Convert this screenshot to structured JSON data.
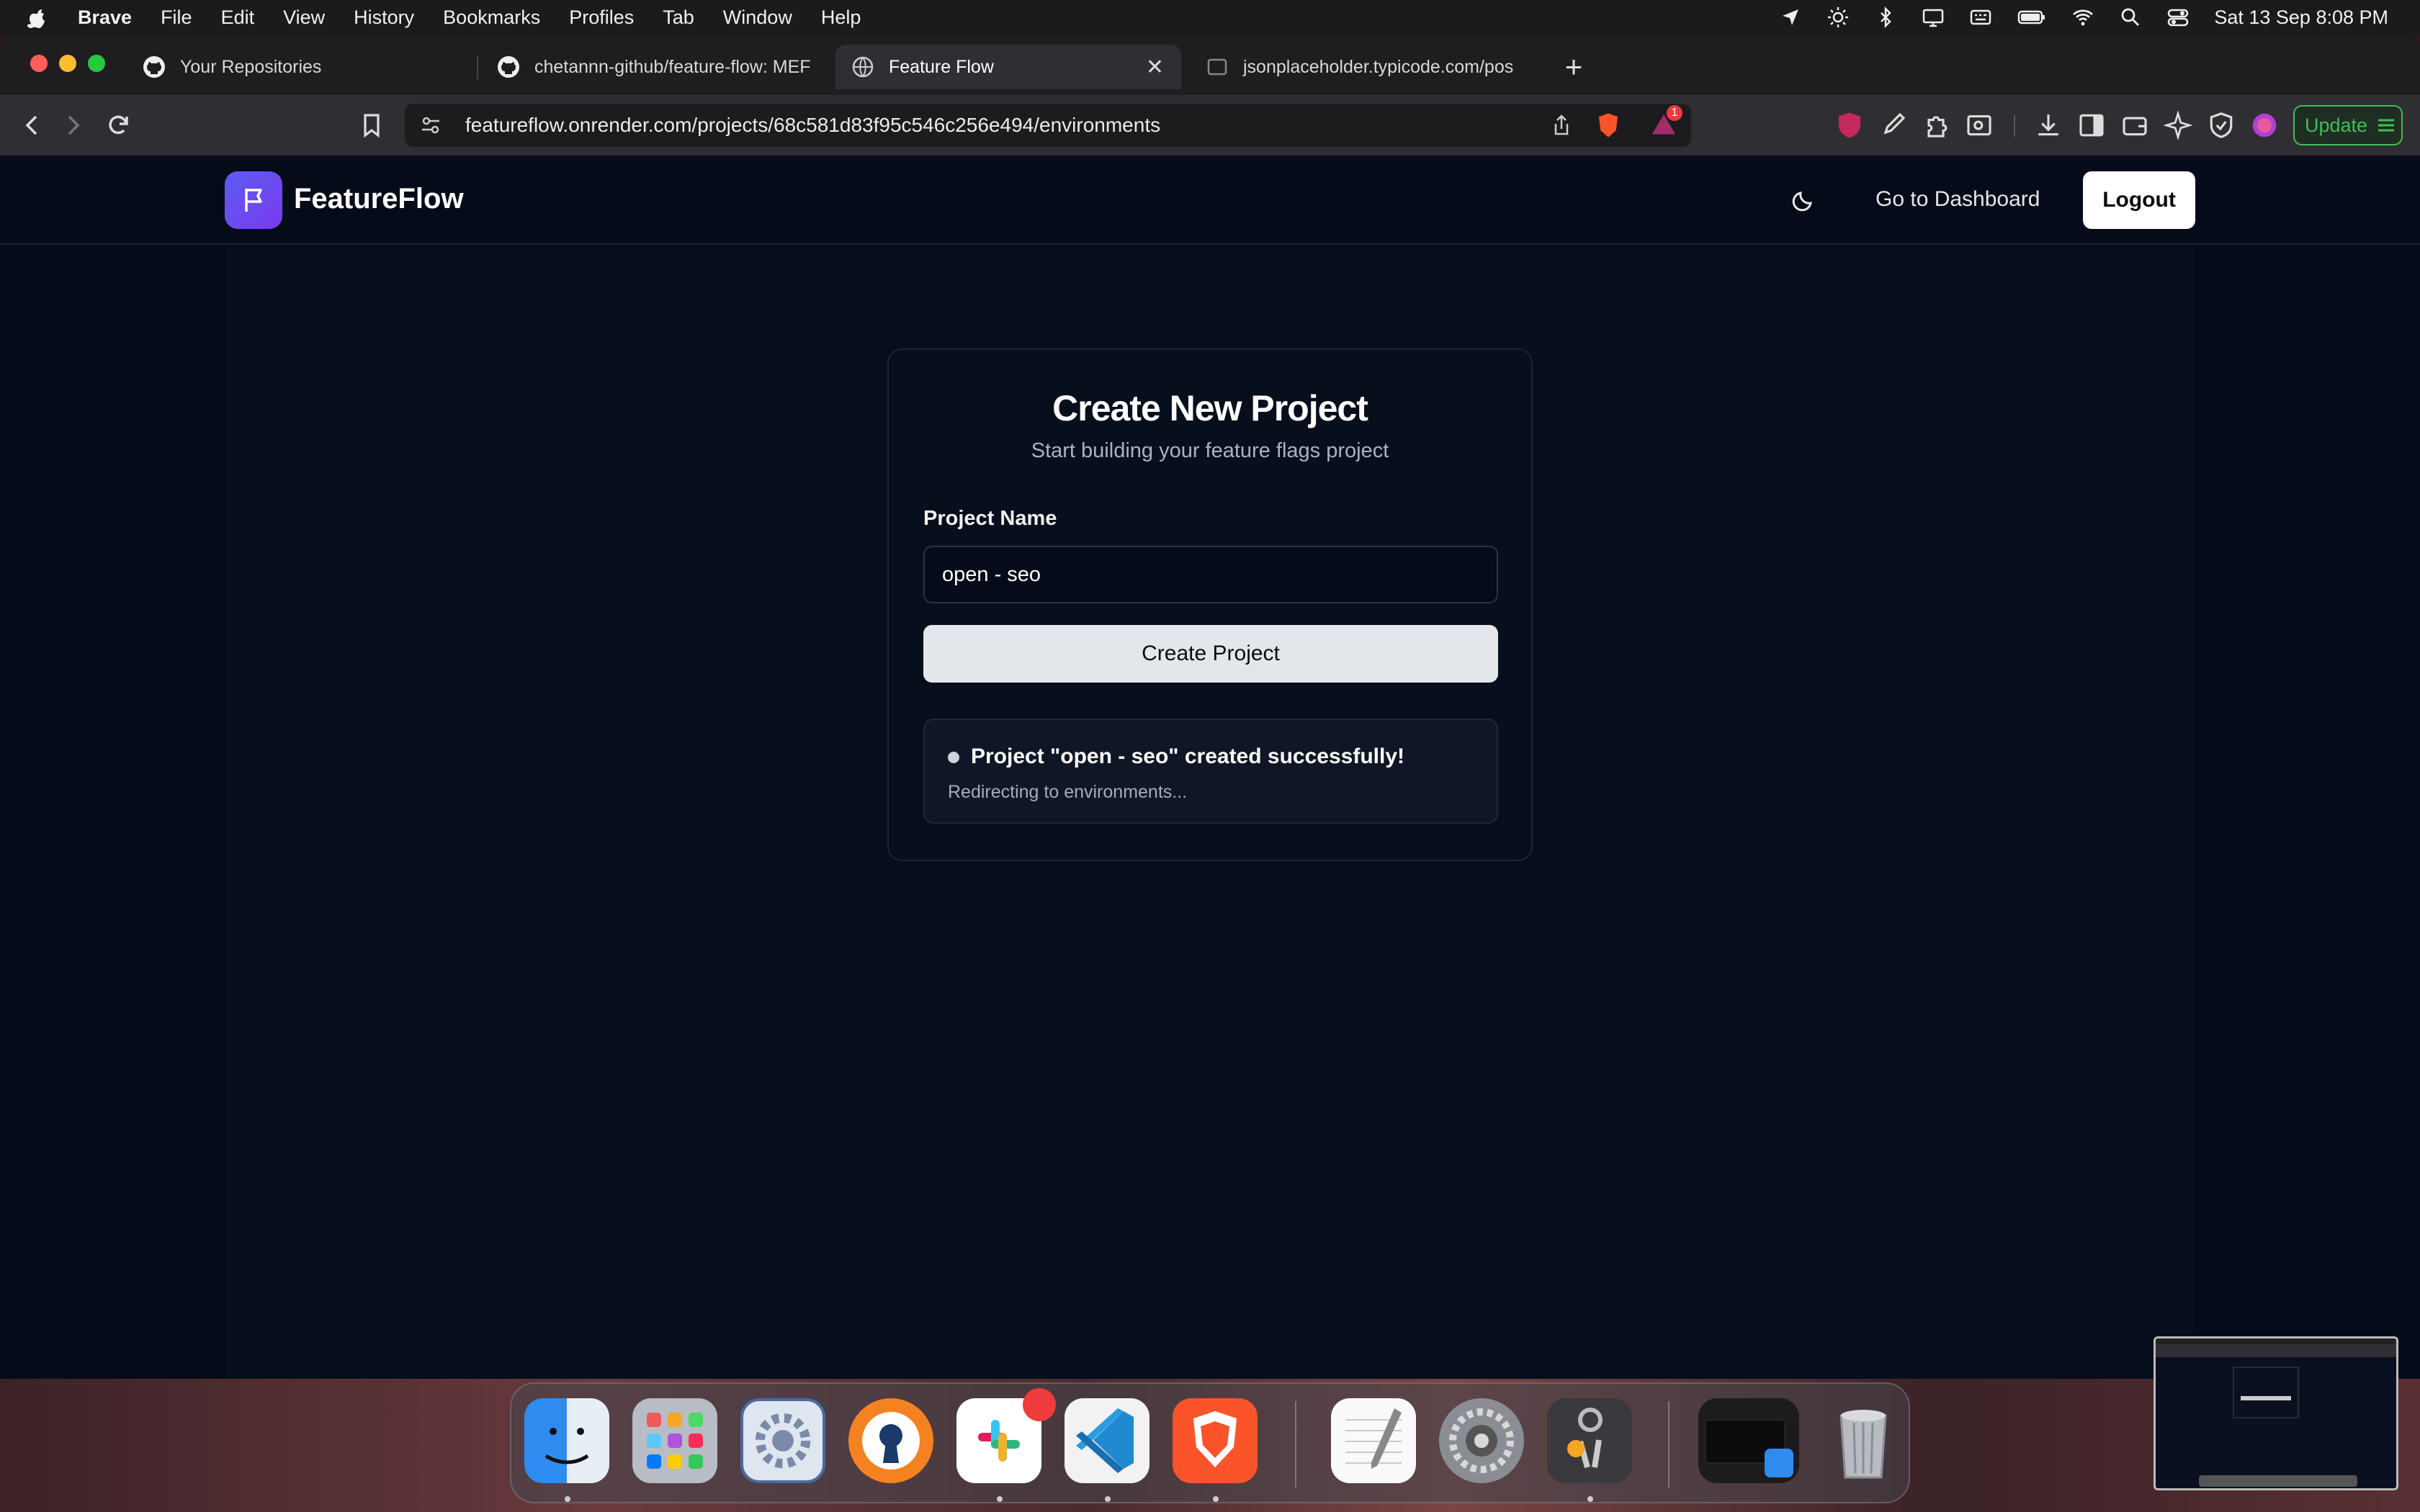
{
  "menubar": {
    "app_name": "Brave",
    "items": [
      "File",
      "Edit",
      "View",
      "History",
      "Bookmarks",
      "Profiles",
      "Tab",
      "Window",
      "Help"
    ],
    "clock": "Sat 13 Sep  8:08 PM"
  },
  "tabs": [
    {
      "label": "Your Repositories",
      "active": false
    },
    {
      "label": "chetannn-github/feature-flow: MEF",
      "active": false
    },
    {
      "label": "Feature Flow",
      "active": true
    },
    {
      "label": "jsonplaceholder.typicode.com/pos",
      "active": false
    }
  ],
  "toolbar": {
    "url": "featureflow.onrender.com/projects/68c581d83f95c546c256e494/environments",
    "notification_count": "1",
    "update_label": "Update"
  },
  "app": {
    "brand": "FeatureFlow",
    "nav_dashboard": "Go to Dashboard",
    "logout": "Logout",
    "accent": "#5b5cf0"
  },
  "form": {
    "title": "Create New Project",
    "subtitle": "Start building your feature flags project",
    "field_label": "Project Name",
    "field_value": "open - seo",
    "submit_label": "Create Project"
  },
  "toast": {
    "message": "Project \"open - seo\" created successfully!",
    "detail": "Redirecting to environments..."
  },
  "dock": {
    "apps": [
      "finder-icon",
      "launchpad-icon",
      "system-preferences-icon",
      "openvpn-icon",
      "slack-icon",
      "vscode-icon",
      "brave-icon",
      "textedit-icon",
      "settings-icon",
      "keychain-icon",
      "downloads-stack-icon",
      "trash-icon"
    ]
  }
}
